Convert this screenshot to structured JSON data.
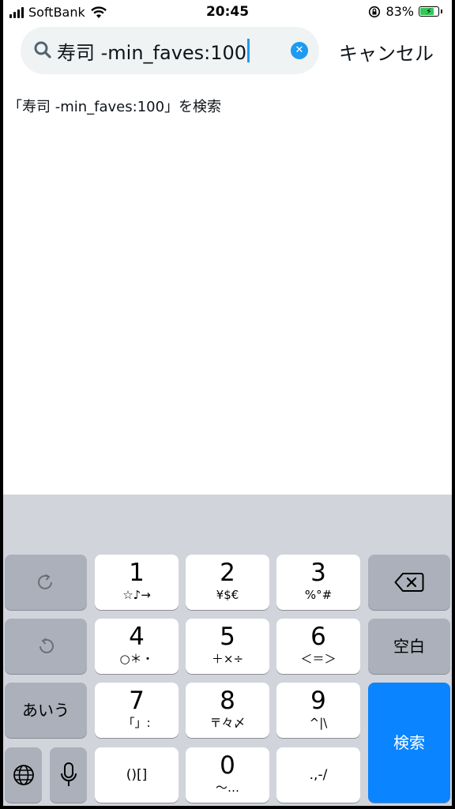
{
  "status": {
    "carrier": "SoftBank",
    "time": "20:45",
    "battery_percent": "83%",
    "battery_level": 0.83,
    "signal_bars": 4,
    "icons": [
      "signal-icon",
      "wifi-icon",
      "rotation-lock-icon",
      "battery-charging-icon"
    ]
  },
  "search": {
    "query": "寿司 -min_faves:100",
    "cancel_label": "キャンセル",
    "suggestion": "「寿司 -min_faves:100」を検索",
    "accent_color": "#1d9bf0"
  },
  "keyboard": {
    "keys": [
      {
        "main": "1",
        "sub": "☆♪→"
      },
      {
        "main": "2",
        "sub": "¥$€"
      },
      {
        "main": "3",
        "sub": "%°#"
      },
      {
        "main": "4",
        "sub": "○＊・"
      },
      {
        "main": "5",
        "sub": "＋×÷"
      },
      {
        "main": "6",
        "sub": "＜＝＞"
      },
      {
        "main": "7",
        "sub": "「」:"
      },
      {
        "main": "8",
        "sub": "〒々〆"
      },
      {
        "main": "9",
        "sub": "^|\\"
      },
      {
        "main": "",
        "sub": "()[]"
      },
      {
        "main": "0",
        "sub": "〜…"
      },
      {
        "main": "",
        "sub": ".,-/"
      }
    ],
    "space_label": "空白",
    "kana_label": "あいう",
    "search_label": "検索",
    "search_color": "#0a84ff"
  }
}
